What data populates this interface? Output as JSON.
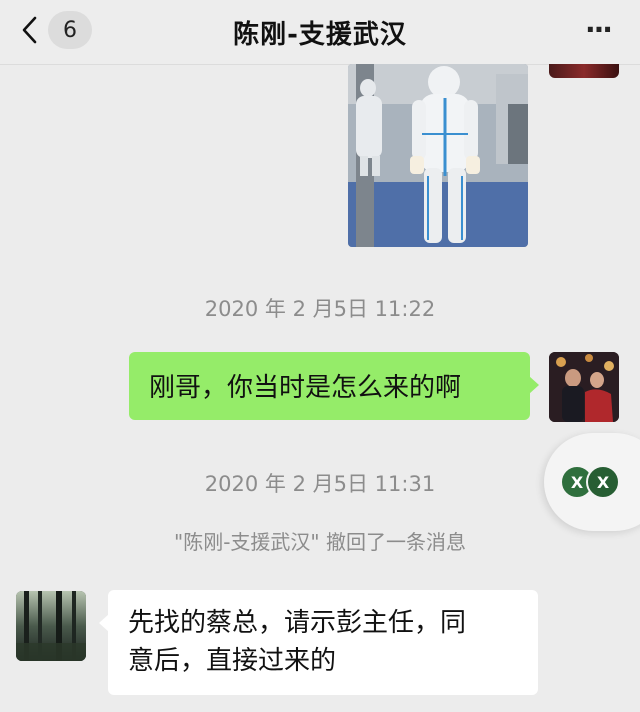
{
  "header": {
    "back_icon": "chevron-left-icon",
    "unread_count": "6",
    "title": "陈刚-支援武汉",
    "more_label": "···"
  },
  "messages": [
    {
      "type": "image",
      "direction": "incoming",
      "description_icon": "photo-thumbnail"
    },
    {
      "type": "timestamp",
      "text": "2020 年 2 月5日 11:22"
    },
    {
      "type": "text",
      "direction": "outgoing",
      "text": "刚哥，你当时是怎么来的啊"
    },
    {
      "type": "timestamp",
      "text": "2020 年 2 月5日 11:31"
    },
    {
      "type": "system",
      "text": "\"陈刚-支援武汉\" 撤回了一条消息"
    },
    {
      "type": "text",
      "direction": "incoming",
      "line1": "先找的蔡总，请示彭主任，同",
      "line2": "意后，直接过来的"
    }
  ],
  "floating_widget": {
    "dot1": "X",
    "dot2": "X"
  },
  "colors": {
    "background": "#ececec",
    "outgoing_bubble": "#95ec69",
    "incoming_bubble": "#ffffff",
    "meta_text": "#8c8c8c"
  }
}
